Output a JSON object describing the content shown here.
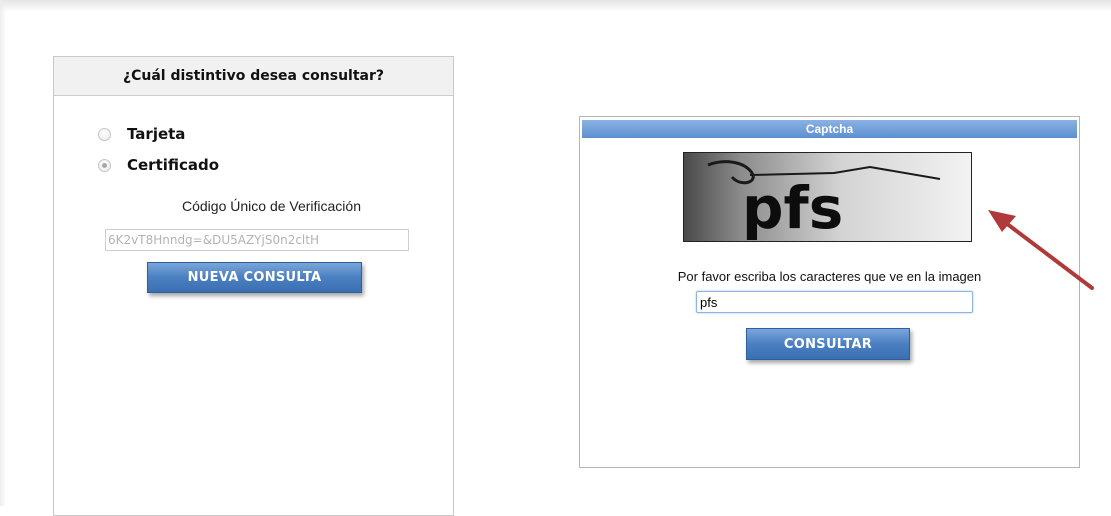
{
  "left_panel": {
    "heading": "¿Cuál distintivo desea consultar?",
    "options": [
      {
        "label": "Tarjeta",
        "selected": false
      },
      {
        "label": "Certificado",
        "selected": true
      }
    ],
    "code_label": "Código Único de Verificación",
    "code_value": "6K2vT8Hnndg=&DU5AZYjS0n2cltH",
    "new_query_button": "NUEVA CONSULTA"
  },
  "captcha_panel": {
    "title": "Captcha",
    "captcha_text": "pfs",
    "prompt": "Por favor escriba los caracteres que ve en la imagen",
    "input_value": "pfs",
    "submit_button": "CONSULTAR"
  },
  "annotation": {
    "icon": "arrow-icon",
    "color": "#b03a3a"
  }
}
